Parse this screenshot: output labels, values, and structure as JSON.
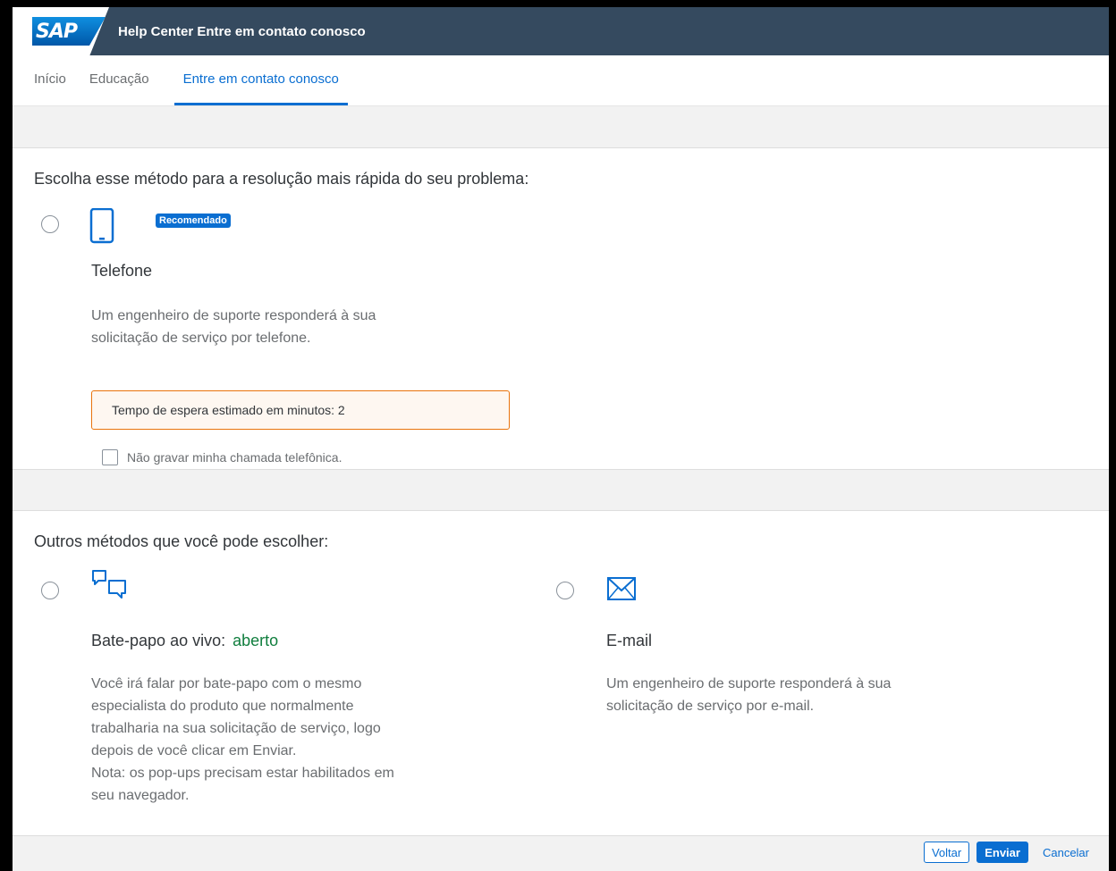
{
  "shell": {
    "logo_text": "SAP",
    "title": "Help Center Entre em contato conosco"
  },
  "tabs": [
    {
      "label": "Início"
    },
    {
      "label": "Educação"
    },
    {
      "label": "Entre em contato conosco"
    }
  ],
  "recommended": {
    "heading": "Escolha esse método para a resolução mais rápida do seu problema:",
    "phone": {
      "badge": "Recomendado",
      "name": "Telefone",
      "desc_line1": "Um engenheiro de suporte responderá à sua",
      "desc_line2": "solicitação de serviço por telefone.",
      "wait_text": "Tempo de espera estimado em minutos: 2",
      "checkbox_label": "Não gravar minha chamada telefônica."
    }
  },
  "others": {
    "heading": "Outros métodos que você pode escolher:",
    "chat": {
      "name": "Bate-papo ao vivo:",
      "status": "aberto",
      "desc": [
        "Você irá falar por bate-papo com o mesmo",
        "especialista do produto que normalmente",
        "trabalharia na sua solicitação de serviço, logo",
        "depois de você clicar em Enviar.",
        "Nota: os pop-ups precisam estar habilitados em",
        "seu navegador."
      ]
    },
    "email": {
      "name": "E-mail",
      "desc": [
        "Um engenheiro de suporte responderá à sua",
        "solicitação de serviço por e-mail."
      ]
    }
  },
  "footer": {
    "back": "Voltar",
    "submit": "Enviar",
    "cancel": "Cancelar"
  },
  "colors": {
    "shell": "#354a5f",
    "accent": "#0a6ed1",
    "warning": "#e9730c",
    "positive": "#107e3e"
  },
  "icons": [
    "phone-icon",
    "chat-icon",
    "email-icon"
  ]
}
